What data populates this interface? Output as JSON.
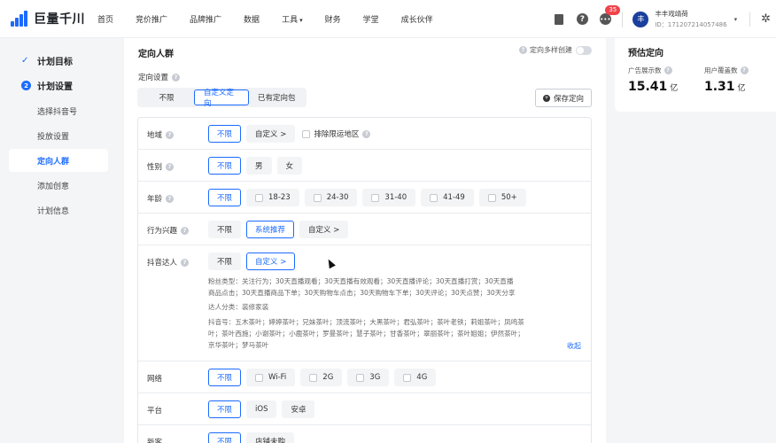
{
  "header": {
    "brand": "巨量千川",
    "nav": [
      "首页",
      "竞价推广",
      "品牌推广",
      "数据",
      "工具",
      "财务",
      "学堂",
      "成长伙伴"
    ],
    "tools_caret": "▾",
    "badge_count": "35",
    "avatar_text": "丰",
    "user_name": "丰丰戏靖荷",
    "user_id": "ID：1712072140574​86",
    "user_caret": "▾",
    "icons": [
      "document-icon",
      "help-icon",
      "message-icon",
      "gear-icon"
    ]
  },
  "sidebar": {
    "steps": [
      {
        "label": "计划目标",
        "marker": "✓"
      },
      {
        "label": "计划设置",
        "marker": "2"
      }
    ],
    "items": [
      "选择抖音号",
      "投放设置",
      "定向人群",
      "添加创意",
      "计划信息"
    ],
    "active_item": "定向人群"
  },
  "main": {
    "section_title": "定向人群",
    "multi_label": "定向多样创建",
    "direction_label": "定向设置",
    "tabs": [
      "不限",
      "自定义定向",
      "已有定向包"
    ],
    "active_tab": "自定义定向",
    "save_button": "保存定向",
    "rows": {
      "region": {
        "label": "地域",
        "options": [
          "不限",
          "自定义 >"
        ],
        "selected": "不限",
        "exclude": "排除限运地区"
      },
      "gender": {
        "label": "性别",
        "options": [
          "不限",
          "男",
          "女"
        ],
        "selected": "不限"
      },
      "age": {
        "label": "年龄",
        "options": [
          "不限",
          "18-23",
          "24-30",
          "31-40",
          "41-49",
          "50+"
        ],
        "selected": "不限"
      },
      "interest": {
        "label": "行为兴趣",
        "options": [
          "不限",
          "系统推荐",
          "自定义 >"
        ],
        "selected": "系统推荐"
      },
      "douyin": {
        "label": "抖音达人",
        "options": [
          "不限",
          "自定义 >"
        ],
        "selected": "自定义 >",
        "fans_line1": "粉丝类型：关注行为；30天直播观看；30天直播有效观看；30天直播评论；30天直播打赏；30天直播",
        "fans_line2": "商品点击；30天直播商品下单；30天购物车点击；30天购物车下单；30天评论；30天点赞；30天分享",
        "category": "达人分类：装修家装",
        "accounts_line1": "抖音号：五木茶叶；婷婷茶叶；兄妹茶叶；顶流茶叶；大黑茶叶；君弘茶叶；茶叶老铁；莉姐茶叶；凤鸣茶",
        "accounts_line2": "叶；茶叶西施；小谢茶叶；小鹿茶叶；罗曼茶叶；慧子茶叶；甘香茶叶；翠丽茶叶；茶叶姐姐；伊然茶叶；",
        "accounts_line3": "京华茶叶；梦马茶叶",
        "collapse": "收起"
      },
      "network": {
        "label": "网络",
        "options": [
          "不限",
          "Wi-Fi",
          "2G",
          "3G",
          "4G"
        ],
        "selected": "不限"
      },
      "platform": {
        "label": "平台",
        "options": [
          "不限",
          "iOS",
          "安卓"
        ],
        "selected": "不限"
      },
      "newcomer": {
        "label": "新客",
        "options": [
          "不限",
          "店铺未购"
        ],
        "selected": "不限"
      }
    }
  },
  "estimate": {
    "title": "预估定向",
    "ad_label": "广告展示数",
    "ad_value": "15.41",
    "ad_unit": "亿",
    "user_label": "用户覆盖数",
    "user_value": "1.31",
    "user_unit": "亿"
  },
  "colors": {
    "accent": "#1b6bff",
    "badge": "#f0434b"
  }
}
